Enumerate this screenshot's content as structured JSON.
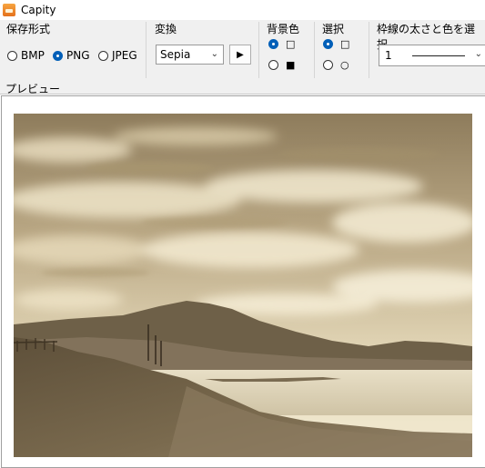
{
  "window": {
    "title": "Capity"
  },
  "groups": {
    "format": {
      "label": "保存形式",
      "options": [
        "BMP",
        "PNG",
        "JPEG"
      ],
      "selected": "PNG"
    },
    "convert": {
      "label": "変換",
      "value": "Sepia",
      "play_glyph": "▶"
    },
    "background": {
      "label": "背景色",
      "options": [
        {
          "glyph": "□",
          "selected": true
        },
        {
          "glyph": "■",
          "selected": false
        }
      ]
    },
    "selection": {
      "label": "選択",
      "options": [
        {
          "glyph": "□",
          "selected": true
        },
        {
          "glyph": "○",
          "selected": false
        }
      ]
    },
    "border": {
      "label": "枠線の太さと色を選択",
      "value": "1"
    }
  },
  "preview": {
    "label": "プレビュー"
  },
  "colors": {
    "accent": "#005fb8",
    "window_bg": "#f0f0f0",
    "sepia_sky_light": "#efe6cc",
    "sepia_sky_dark": "#b9a784",
    "sepia_ground": "#6b5b42"
  },
  "icons": {
    "app": "capity-app-icon",
    "chevron": "chevron-down-icon",
    "play": "play-icon"
  }
}
